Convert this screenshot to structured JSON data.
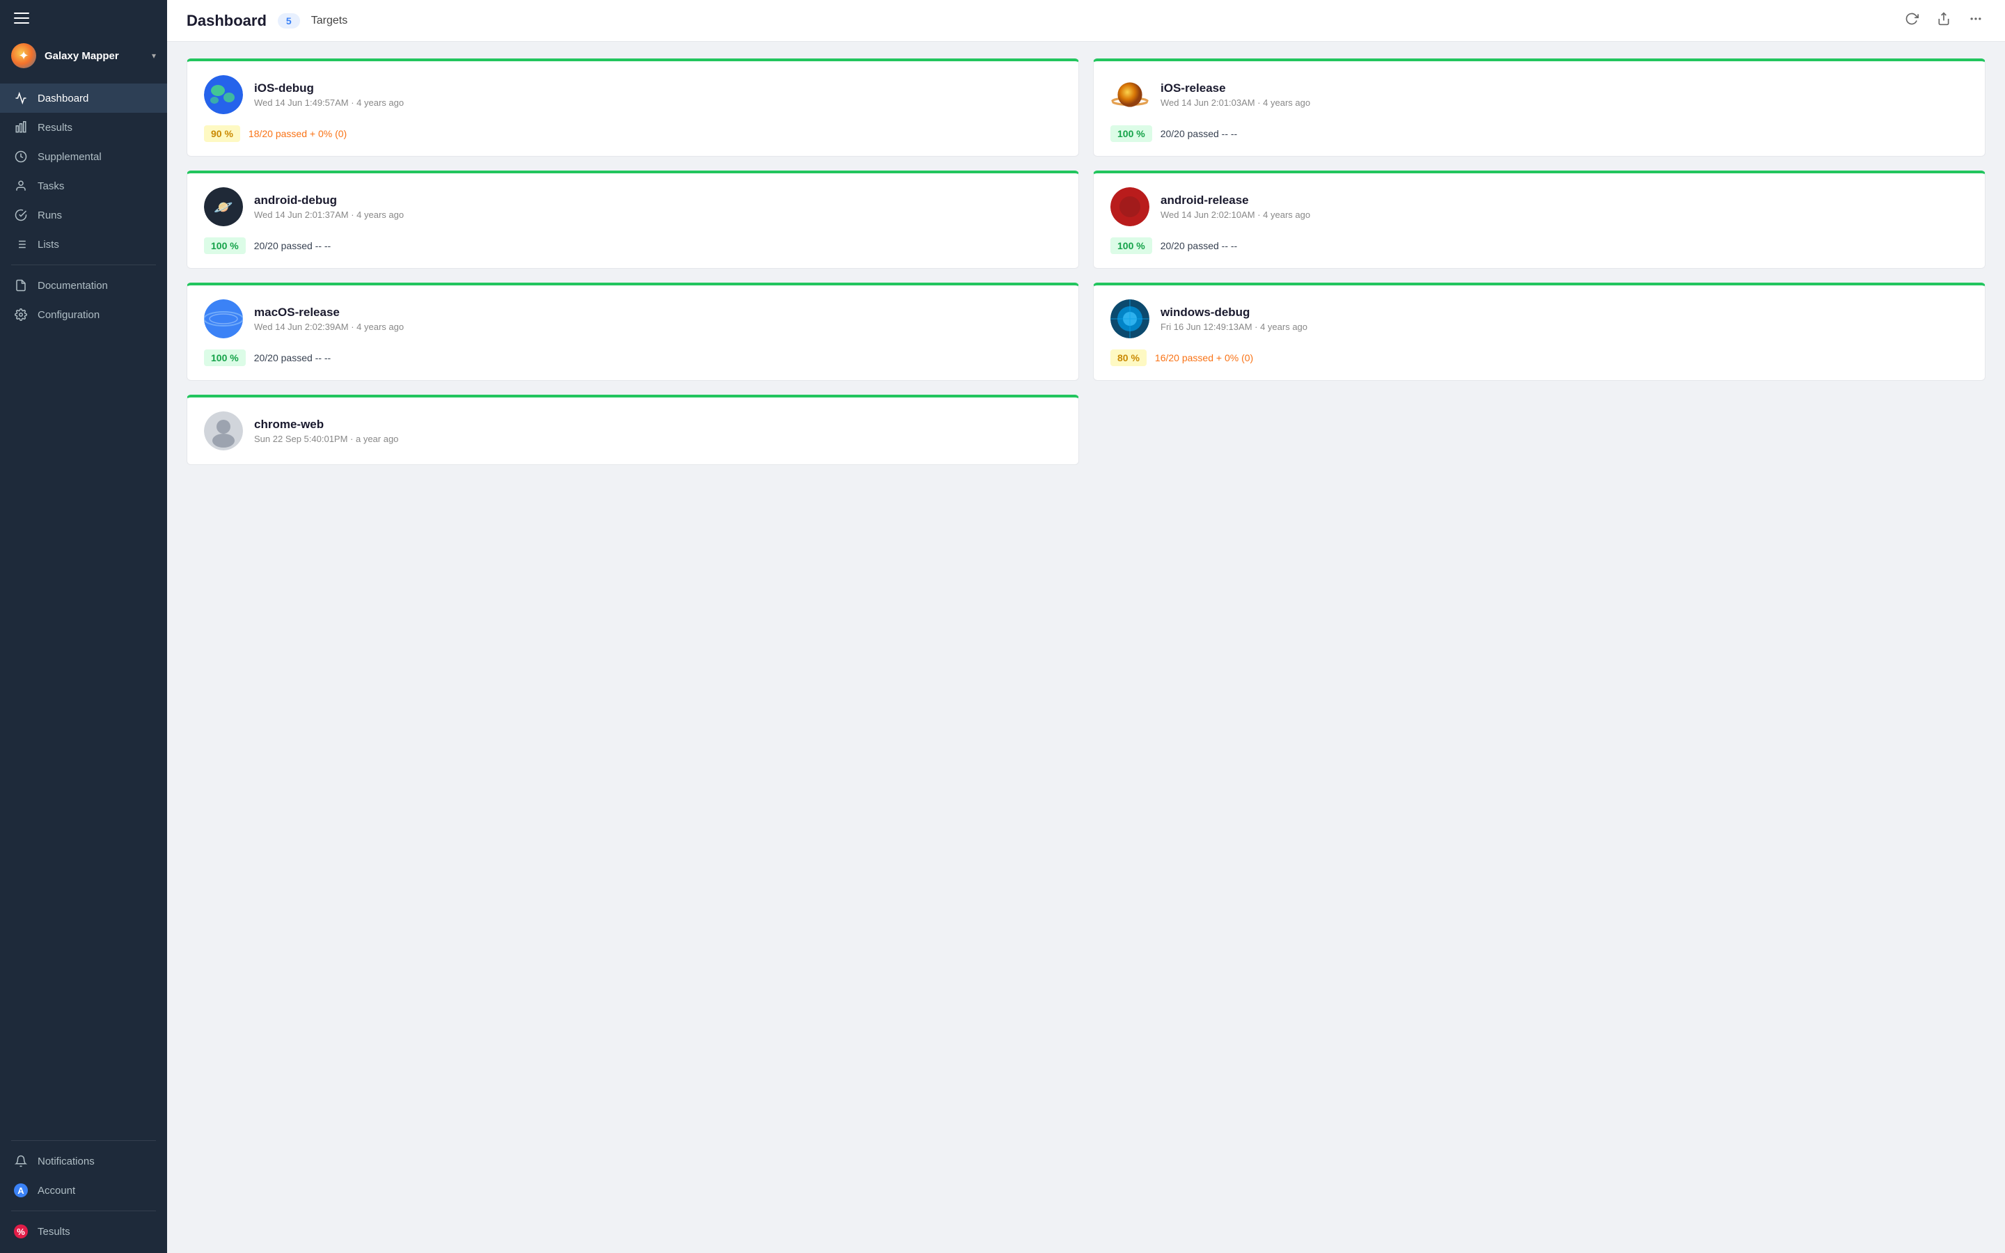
{
  "sidebar": {
    "hamburger_label": "Menu",
    "workspace": {
      "name": "Galaxy Mapper",
      "chevron": "▾"
    },
    "nav_items": [
      {
        "id": "dashboard",
        "label": "Dashboard",
        "icon": "chart-line",
        "active": true
      },
      {
        "id": "results",
        "label": "Results",
        "icon": "bar-chart",
        "active": false
      },
      {
        "id": "supplemental",
        "label": "Supplemental",
        "icon": "clock",
        "active": false
      },
      {
        "id": "tasks",
        "label": "Tasks",
        "icon": "person",
        "active": false
      },
      {
        "id": "runs",
        "label": "Runs",
        "icon": "check-circle",
        "active": false
      },
      {
        "id": "lists",
        "label": "Lists",
        "icon": "list",
        "active": false
      }
    ],
    "nav_items_bottom": [
      {
        "id": "documentation",
        "label": "Documentation",
        "icon": "doc"
      },
      {
        "id": "configuration",
        "label": "Configuration",
        "icon": "gear"
      }
    ],
    "footer_items": [
      {
        "id": "notifications",
        "label": "Notifications",
        "icon": "bell"
      },
      {
        "id": "account",
        "label": "Account",
        "icon": "user"
      },
      {
        "id": "tesults",
        "label": "Tesults",
        "icon": "percent"
      }
    ]
  },
  "header": {
    "title": "Dashboard",
    "badge": "5",
    "targets_label": "Targets",
    "refresh_label": "Refresh",
    "share_label": "Share",
    "more_label": "More"
  },
  "cards": [
    {
      "id": "ios-debug",
      "name": "iOS-debug",
      "date": "Wed 14 Jun 1:49:57AM · 4 years ago",
      "planet_class": "planet-earth",
      "planet_emoji": "🌍",
      "pct": "90 %",
      "pct_class": "badge-yellow",
      "passed": "18/20 passed + 0% (0)",
      "passed_class": "passed-orange",
      "border_color": "#22c55e"
    },
    {
      "id": "ios-release",
      "name": "iOS-release",
      "date": "Wed 14 Jun 2:01:03AM · 4 years ago",
      "planet_class": "planet-saturn",
      "planet_emoji": "🪐",
      "pct": "100 %",
      "pct_class": "badge-green",
      "passed": "20/20 passed -- --",
      "passed_class": "",
      "border_color": "#22c55e"
    },
    {
      "id": "android-debug",
      "name": "android-debug",
      "date": "Wed 14 Jun 2:01:37AM · 4 years ago",
      "planet_class": "planet-android",
      "planet_emoji": "🪐",
      "pct": "100 %",
      "pct_class": "badge-green",
      "passed": "20/20 passed -- --",
      "passed_class": "",
      "border_color": "#22c55e"
    },
    {
      "id": "android-release",
      "name": "android-release",
      "date": "Wed 14 Jun 2:02:10AM · 4 years ago",
      "planet_class": "planet-android-r",
      "planet_emoji": "🔴",
      "pct": "100 %",
      "pct_class": "badge-green",
      "passed": "20/20 passed -- --",
      "passed_class": "",
      "border_color": "#22c55e"
    },
    {
      "id": "macos-release",
      "name": "macOS-release",
      "date": "Wed 14 Jun 2:02:39AM · 4 years ago",
      "planet_class": "planet-macos",
      "planet_emoji": "🌐",
      "pct": "100 %",
      "pct_class": "badge-green",
      "passed": "20/20 passed -- --",
      "passed_class": "",
      "border_color": "#22c55e"
    },
    {
      "id": "windows-debug",
      "name": "windows-debug",
      "date": "Fri 16 Jun 12:49:13AM · 4 years ago",
      "planet_class": "planet-windows",
      "planet_emoji": "🌐",
      "pct": "80 %",
      "pct_class": "badge-yellow",
      "passed": "16/20 passed + 0% (0)",
      "passed_class": "passed-orange",
      "border_color": "#22c55e"
    },
    {
      "id": "chrome-web",
      "name": "chrome-web",
      "date": "Sun 22 Sep 5:40:01PM · a year ago",
      "planet_class": "planet-placeholder",
      "planet_emoji": "",
      "pct": "",
      "pct_class": "",
      "passed": "",
      "passed_class": "",
      "border_color": "#22c55e"
    }
  ]
}
